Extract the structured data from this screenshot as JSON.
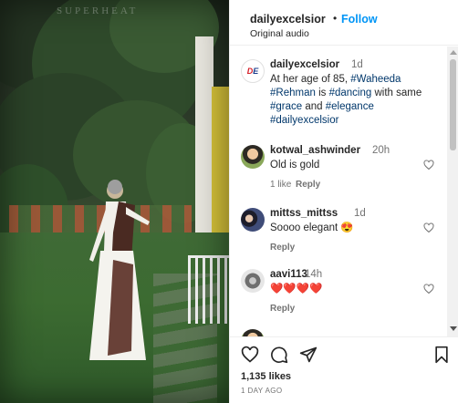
{
  "media": {
    "watermark": "SUPERHEAT"
  },
  "header": {
    "username": "dailyexcelsior",
    "separator": "•",
    "follow_label": "Follow",
    "audio": "Original audio",
    "more_icon": "more-horizontal-icon"
  },
  "caption": {
    "avatar_text_a": "D",
    "avatar_text_b": "E",
    "username": "dailyexcelsior",
    "time": "1d",
    "text_1": "At her age of 85,",
    "tag_1": "#Waheeda",
    "tag_2": "#Rehman",
    "text_2": "is",
    "tag_3": "#dancing",
    "text_3": "with same",
    "tag_4": "#grace",
    "text_4": "and",
    "tag_5": "#elegance",
    "tag_6": "#dailyexcelsior"
  },
  "comments": [
    {
      "username": "kotwal_ashwinder",
      "time": "20h",
      "text": "Old is gold",
      "likes": "1 like",
      "reply": "Reply"
    },
    {
      "username": "mittss_mittss",
      "time": "1d",
      "text": "Soooo elegant 😍",
      "reply": "Reply"
    },
    {
      "username": "aavi113",
      "time": "14h",
      "text": "❤️❤️❤️❤️",
      "reply": "Reply"
    }
  ],
  "footer": {
    "likes": "1,135 likes",
    "date": "1 DAY AGO"
  },
  "colors": {
    "accent": "#0095f6",
    "hashtag": "#00376b",
    "secondary_text": "#737373"
  }
}
